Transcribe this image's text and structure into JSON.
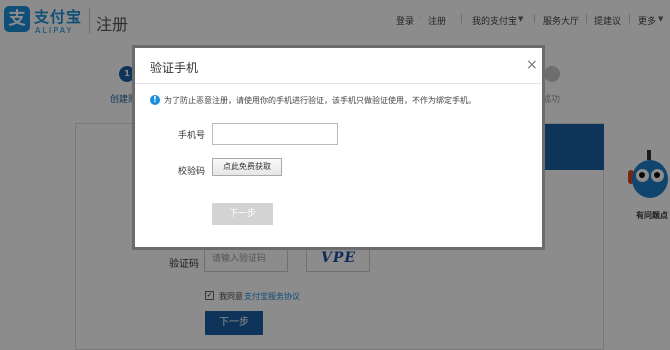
{
  "header": {
    "logo_glyph": "支",
    "brand_cn": "支付宝",
    "brand_en": "ALIPAY",
    "page_name": "注册",
    "nav": {
      "login": "登录",
      "register": "注册",
      "my_alipay": "我的支付宝",
      "service_hall": "服务大厅",
      "feedback": "提建议",
      "more": "更多"
    }
  },
  "steps": {
    "step1_number": "1",
    "step1_label": "创建账",
    "final_label": "成功"
  },
  "form": {
    "captcha_label": "验证码",
    "captcha_placeholder": "请输入验证码",
    "captcha_image_text": "VPE",
    "agree_prefix": "我同意",
    "agree_link": "支付宝服务协议",
    "agree_checked": true,
    "next_button": "下一步"
  },
  "mascot": {
    "label": "有问题点"
  },
  "dialog": {
    "title": "验证手机",
    "close_symbol": "×",
    "info_text": "为了防止恶意注册，请使用你的手机进行验证，该手机只做验证使用，不作为绑定手机。",
    "phone_label": "手机号",
    "phone_value": "",
    "code_label": "校验码",
    "get_code_button": "点此免费获取",
    "next_button": "下一步"
  },
  "colors": {
    "brand_blue": "#1a8fd9",
    "dark_blue": "#1d5fa3",
    "disabled_gray": "#d3d3d3"
  }
}
